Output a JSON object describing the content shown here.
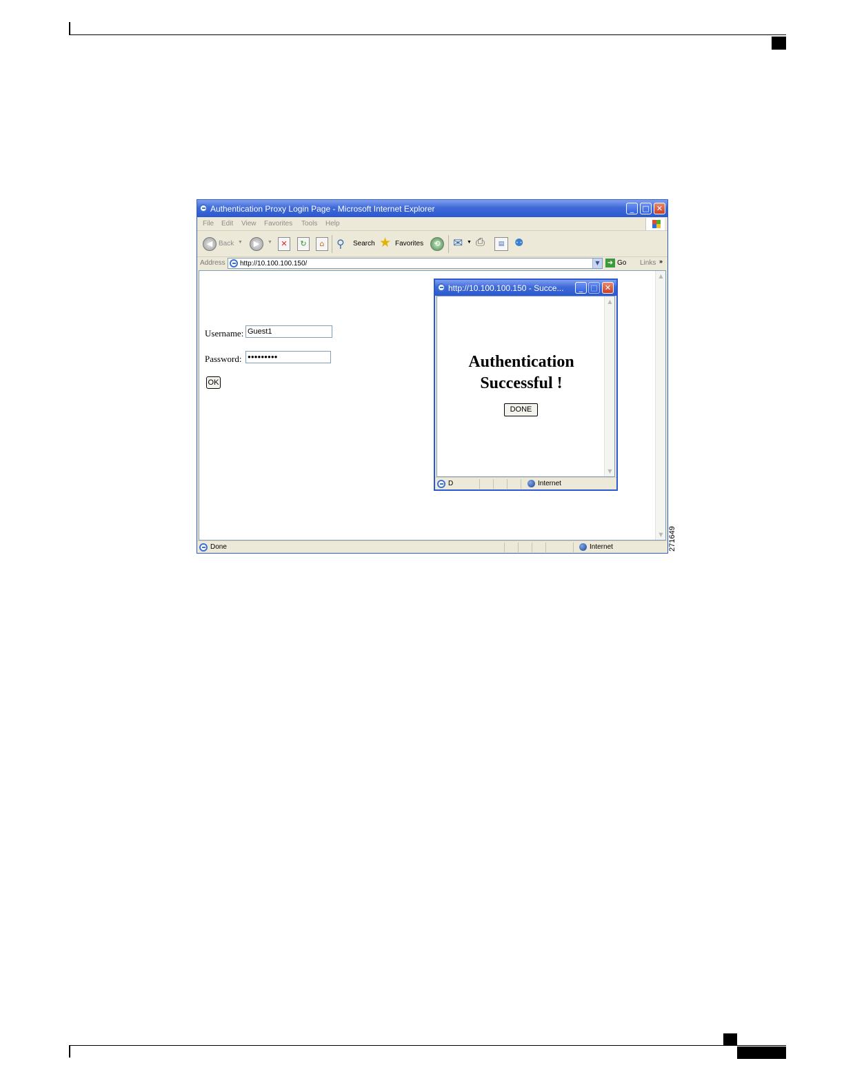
{
  "main_window": {
    "title": "Authentication Proxy Login Page - Microsoft Internet Explorer",
    "menu": [
      "File",
      "Edit",
      "View",
      "Favorites",
      "Tools",
      "Help"
    ],
    "toolbar": {
      "back_label": "Back",
      "search_label": "Search",
      "favorites_label": "Favorites"
    },
    "address": {
      "label": "Address",
      "url": "http://10.100.100.150/",
      "go_label": "Go",
      "links_label": "Links",
      "links_chevron": "»"
    },
    "form": {
      "username_label": "Username:",
      "username_value": "Guest1",
      "password_label": "Password:",
      "password_value": "●●●●●●●●●",
      "ok_label": "OK"
    },
    "status": {
      "text": "Done",
      "zone": "Internet"
    }
  },
  "popup_window": {
    "title": "http://10.100.100.150 - Succe...",
    "message_line1": "Authentication",
    "message_line2": "Successful !",
    "done_label": "DONE",
    "status": {
      "text": "D",
      "zone": "Internet"
    }
  },
  "figure_number": "271649",
  "colors": {
    "titlebar_blue": "#2c58cf",
    "chrome": "#ece9d8",
    "close_red": "#c9402a"
  }
}
